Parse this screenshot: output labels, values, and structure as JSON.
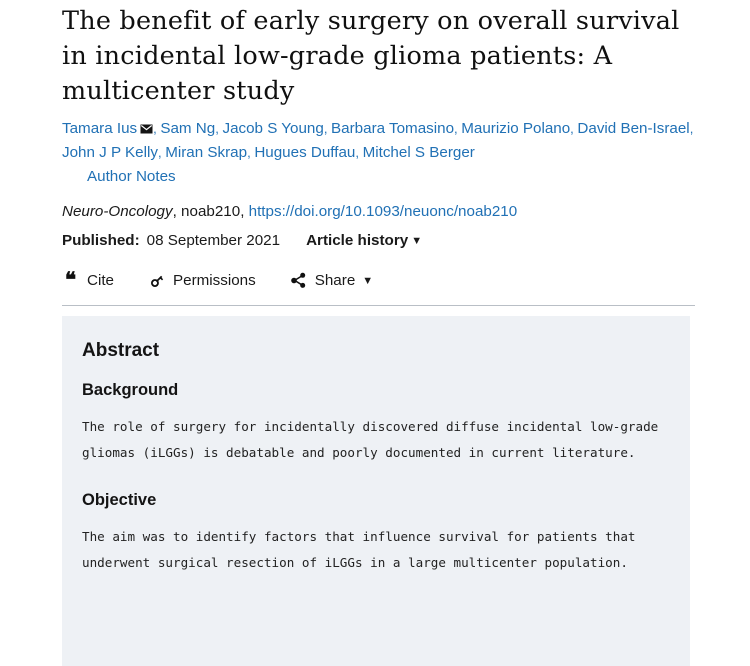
{
  "article": {
    "title": "The benefit of early surgery on overall survival in incidental low-grade glioma patients: A multicenter study",
    "authors": [
      {
        "name": "Tamara Ius",
        "has_corresponding_icon": true
      },
      {
        "name": "Sam Ng",
        "has_corresponding_icon": false
      },
      {
        "name": "Jacob S Young",
        "has_corresponding_icon": false
      },
      {
        "name": "Barbara Tomasino",
        "has_corresponding_icon": false
      },
      {
        "name": "Maurizio Polano",
        "has_corresponding_icon": false
      },
      {
        "name": "David Ben-Israel",
        "has_corresponding_icon": false
      },
      {
        "name": "John J P Kelly",
        "has_corresponding_icon": false
      },
      {
        "name": "Miran Skrap",
        "has_corresponding_icon": false
      },
      {
        "name": "Hugues Duffau",
        "has_corresponding_icon": false
      },
      {
        "name": "Mitchel S Berger",
        "has_corresponding_icon": false
      }
    ],
    "author_notes_label": "Author Notes",
    "author_separator": ",",
    "corresponding_icon": "envelope-icon",
    "journal_name": "Neuro-Oncology",
    "article_id": "noab210",
    "doi_url": "https://doi.org/10.1093/neuonc/noab210",
    "published_label": "Published:",
    "published_date": "08 September 2021",
    "article_history_label": "Article history",
    "caret_glyph": "▼"
  },
  "toolbar": {
    "items": [
      {
        "icon": "quote-icon",
        "label": "Cite",
        "glyph": "❝",
        "has_caret": false
      },
      {
        "icon": "key-icon",
        "label": "Permissions",
        "has_caret": false
      },
      {
        "icon": "share-icon",
        "label": "Share",
        "has_caret": true,
        "caret_glyph": "▼"
      }
    ]
  },
  "abstract": {
    "heading": "Abstract",
    "sections": [
      {
        "heading": "Background",
        "body": "The role of surgery for incidentally discovered diffuse incidental low-grade gliomas (iLGGs) is debatable and poorly documented in current literature."
      },
      {
        "heading": "Objective",
        "body": "The aim was to identify factors that influence survival for patients that underwent surgical resection of iLGGs in a large multicenter population."
      }
    ]
  },
  "colors": {
    "link_blue": "#2171b5",
    "panel_background": "#eef1f5",
    "divider": "#b9bfc6",
    "text": "#1a1a1a"
  }
}
